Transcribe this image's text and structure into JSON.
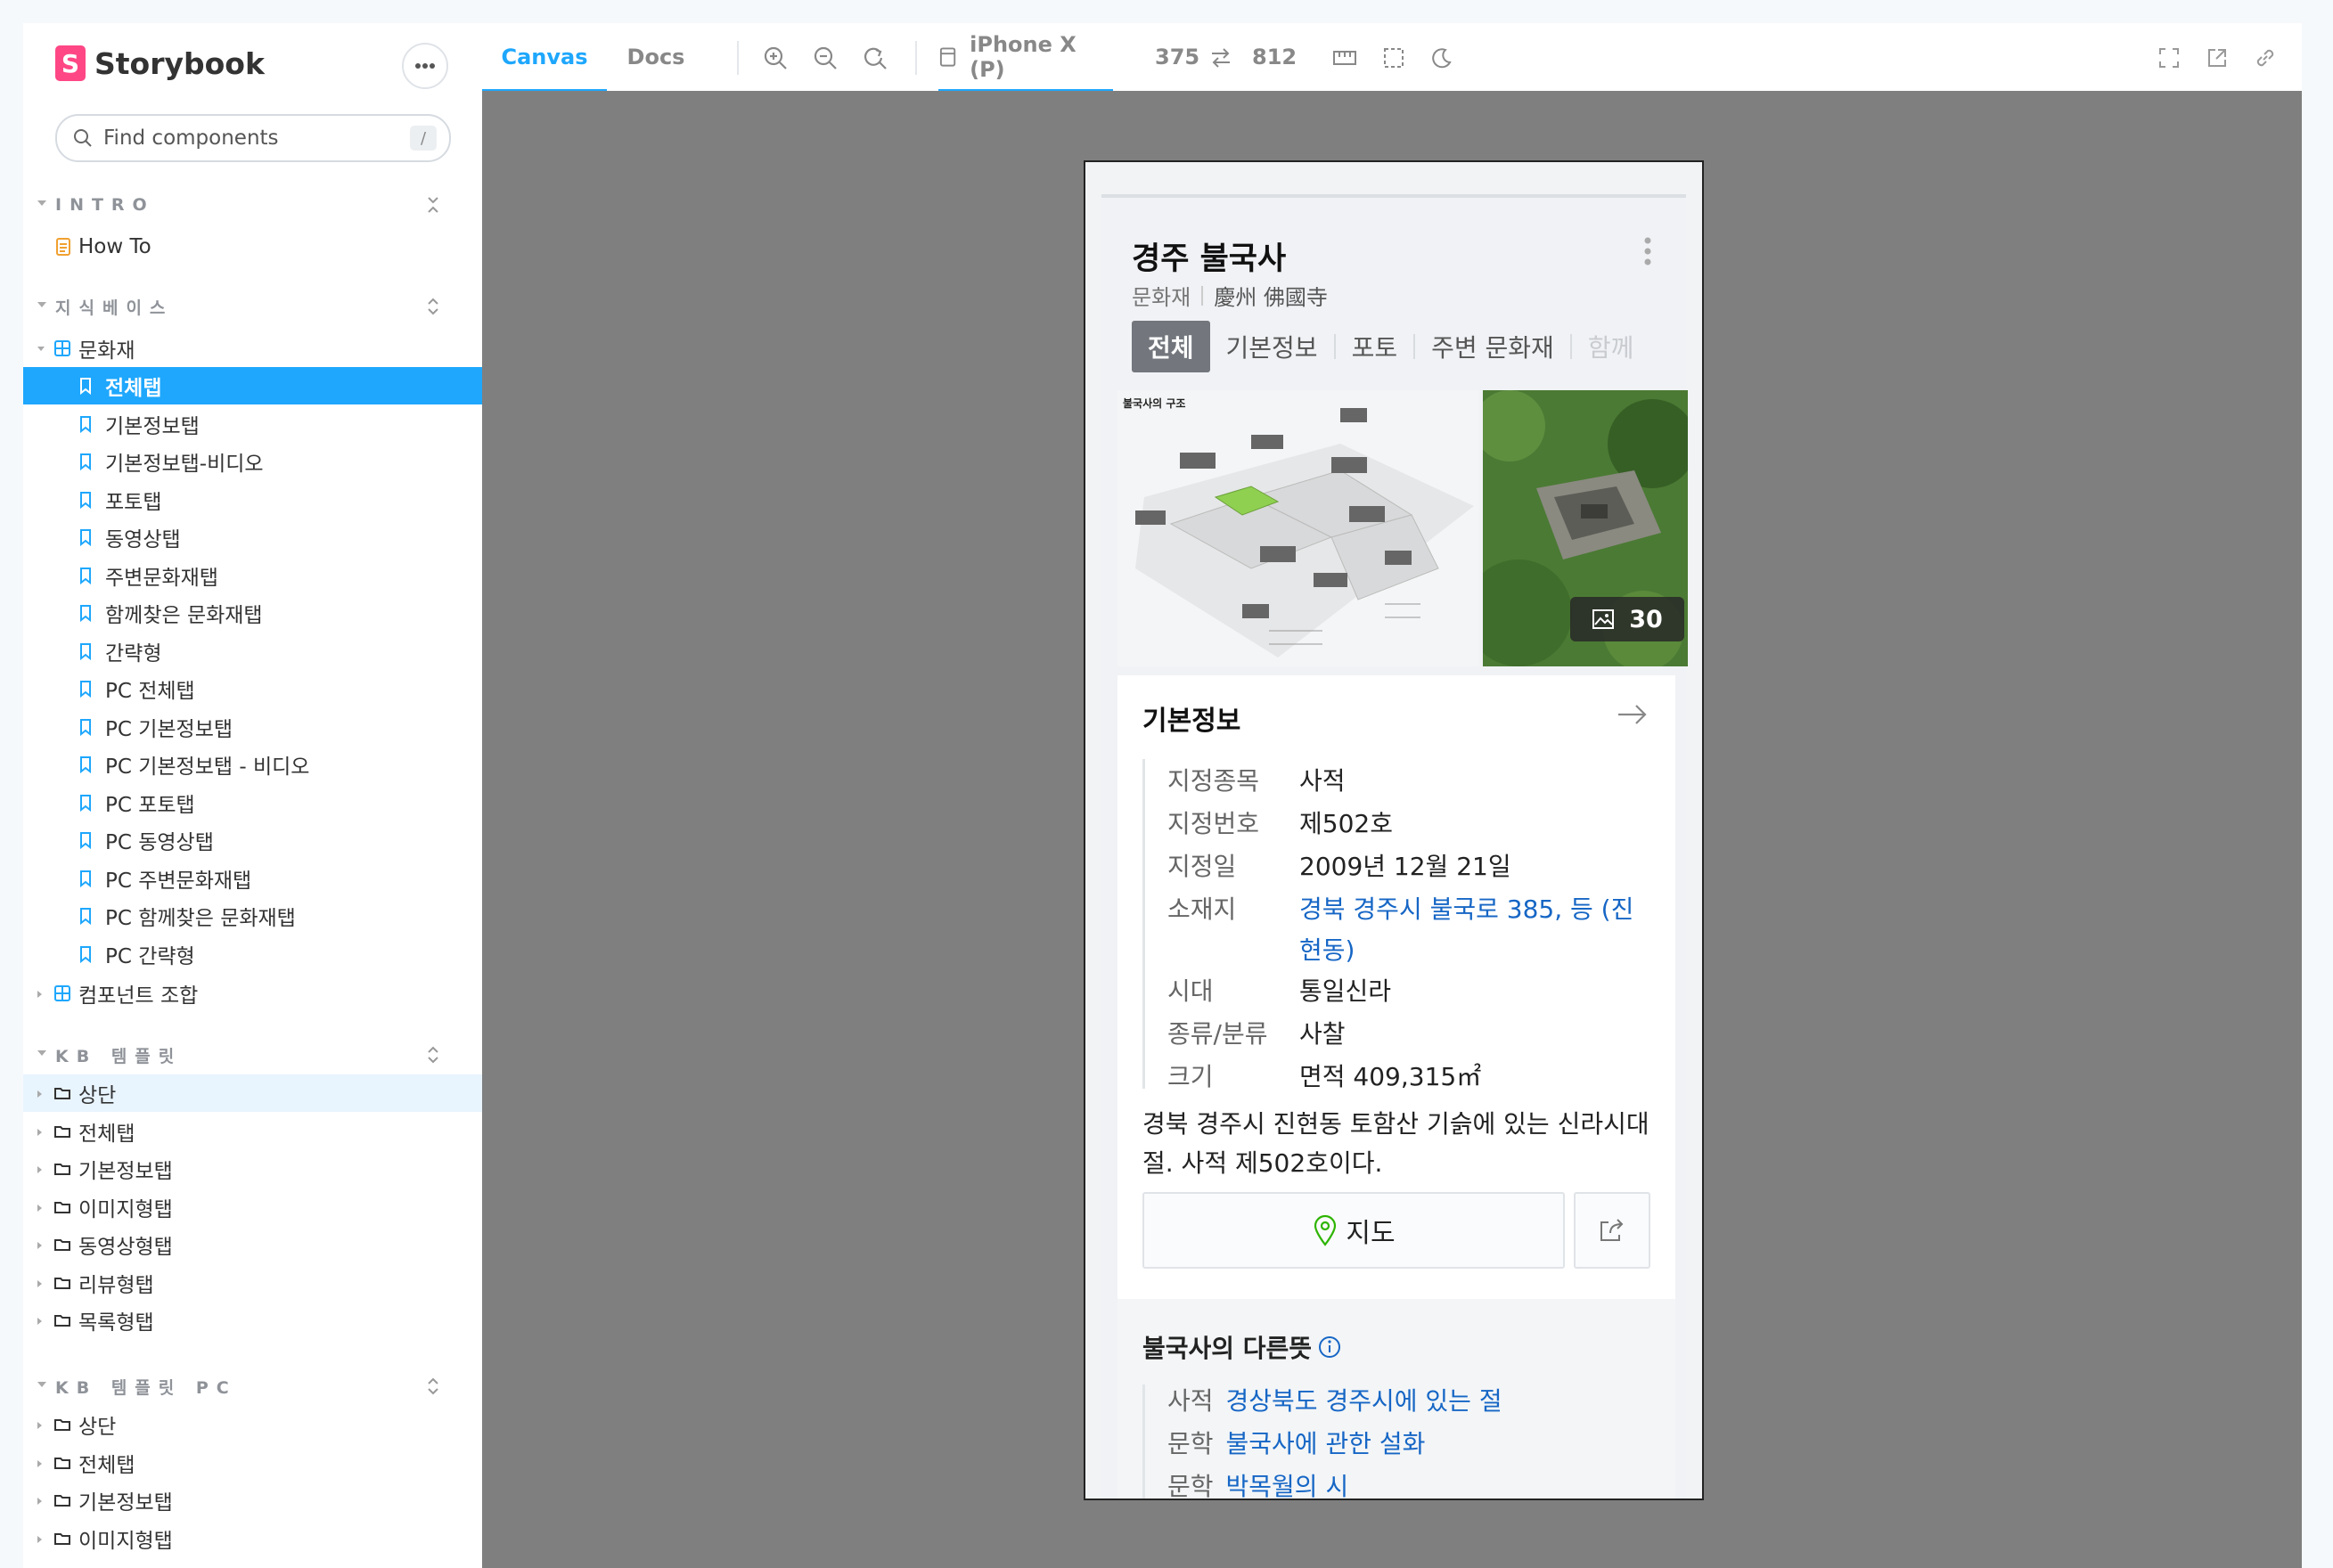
{
  "sidebar": {
    "brand": "Storybook",
    "search_placeholder": "Find components",
    "search_shortcut": "/",
    "groups": {
      "intro": {
        "title": "INTRO",
        "items": [
          "How To"
        ]
      },
      "kb": {
        "title": "지식베이스",
        "folder": "문화재",
        "stories": [
          "전체탭",
          "기본정보탭",
          "기본정보탭-비디오",
          "포토탭",
          "동영상탭",
          "주변문화재탭",
          "함께찾은 문화재탭",
          "간략형",
          "PC 전체탭",
          "PC 기본정보탭",
          "PC 기본정보탭 - 비디오",
          "PC 포토탭",
          "PC 동영상탭",
          "PC 주변문화재탭",
          "PC 함께찾은 문화재탭",
          "PC 간략형"
        ],
        "folder2": "컴포넌트 조합"
      },
      "kb_template": {
        "title": "KB 템플릿",
        "items": [
          "상단",
          "전체탭",
          "기본정보탭",
          "이미지형탭",
          "동영상형탭",
          "리뷰형탭",
          "목록형탭"
        ]
      },
      "kb_template_pc": {
        "title": "KB 템플릿 PC",
        "items": [
          "상단",
          "전체탭",
          "기본정보탭",
          "이미지형탭"
        ]
      }
    }
  },
  "toolbar": {
    "tabs": [
      "Canvas",
      "Docs"
    ],
    "device": "iPhone X (P)",
    "width": "375",
    "height": "812"
  },
  "content": {
    "title": "경주 불국사",
    "category": "문화재",
    "hanja": "慶州 佛國寺",
    "tabs": [
      "전체",
      "기본정보",
      "포토",
      "주변 문화재",
      "함께"
    ],
    "gallery": {
      "caption": "불국사의 구조",
      "count": "30"
    },
    "info": {
      "title": "기본정보",
      "rows": [
        {
          "k": "지정종목",
          "v": "사적"
        },
        {
          "k": "지정번호",
          "v": "제502호"
        },
        {
          "k": "지정일",
          "v": "2009년 12월 21일"
        },
        {
          "k": "소재지",
          "v": "경북 경주시 불국로 385, 등 (진현동)"
        },
        {
          "k": "시대",
          "v": "통일신라"
        },
        {
          "k": "종류/분류",
          "v": "사찰"
        },
        {
          "k": "크기",
          "v": "면적 409,315㎡"
        }
      ],
      "description": "경북 경주시 진현동 토함산 기슭에 있는 신라시대 절. 사적 제502호이다.",
      "map_button": "지도"
    },
    "other": {
      "title": "불국사의 다른뜻",
      "rows": [
        {
          "k": "사적",
          "v": "경상북도 경주시에 있는 절"
        },
        {
          "k": "문학",
          "v": "불국사에 관한 설화"
        },
        {
          "k": "문학",
          "v": "박목월의 시"
        }
      ]
    }
  }
}
